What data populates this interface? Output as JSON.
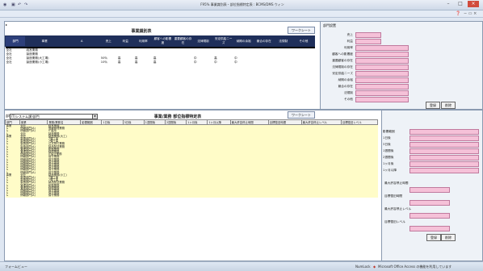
{
  "window": {
    "title": "F95% 事業識別表・部位指標特定表 : BCMS/DMS ウィン",
    "minimize": "–",
    "maximize": "□",
    "close": "×"
  },
  "ribbon": {
    "help": "❓",
    "controls": "− ▭ ×"
  },
  "top_section": {
    "title": "事業識別表",
    "worksheet_btn": "ワークシート",
    "columns": [
      "部門",
      "事業",
      "A",
      "売上",
      "利益",
      "利用率",
      "顧客への影響度",
      "重要顧客の存在",
      "法律規制",
      "安定供給ニーズ",
      "納期の余裕",
      "競合の存在",
      "法規制",
      "その他"
    ],
    "rows": [
      {
        "dept": "全社",
        "biz": "経営業務",
        "c1": "",
        "c2": "",
        "c3": "",
        "c4": "",
        "c5": "",
        "c6": "",
        "c7": ""
      },
      {
        "dept": "全社",
        "biz": "製造業務",
        "c1": "",
        "c2": "",
        "c3": "",
        "c4": "",
        "c5": "",
        "c6": "",
        "c7": ""
      },
      {
        "dept": "全社",
        "biz": "製造業務(大工場)",
        "c1": "50％",
        "c2": "高",
        "c3": "高",
        "c4": "高",
        "c5": "中",
        "c6": "高",
        "c7": "中"
      },
      {
        "dept": "全社",
        "biz": "製造業務(小工場)",
        "c1": "10％",
        "c2": "高",
        "c3": "高",
        "c4": "高",
        "c5": "中",
        "c6": "中",
        "c7": "中"
      }
    ]
  },
  "right_form": {
    "title": "部門設置",
    "labels": [
      "売上",
      "利益",
      "利用率",
      "顧客への影響度",
      "重要顧客の存在",
      "法律規制の存在",
      "安定供給ニーズ",
      "納期の余裕",
      "競合の存在",
      "法規制",
      "その他"
    ],
    "register_btn": "登録",
    "delete_btn": "削除"
  },
  "bottom_section": {
    "combo_label": "部門",
    "combo_value": "IT(システム課)部門",
    "title": "事業/業務 部位指標特定表",
    "worksheet_btn": "ワークシート",
    "columns": [
      "部門",
      "事業",
      "業務/業務名",
      "影響範囲",
      "1日後",
      "3日後",
      "1週間後",
      "2週間後",
      "1ヶ月後",
      "1ヶ月以降",
      "最大許容停止時間",
      "目標復旧時間",
      "最大許容停止レベル",
      "目標復旧レベル"
    ],
    "rows": [
      {
        "dept": "事業",
        "biz": "全社",
        "task": "経営業務"
      },
      {
        "dept": "↳",
        "biz": "情報部門(A)",
        "task": "情報管理業務"
      },
      {
        "dept": "↳",
        "biz": "情報部門(A)",
        "task": "IT運用"
      },
      {
        "dept": "↳",
        "biz": "全社",
        "task": "製造業務"
      },
      {
        "dept": "事業",
        "biz": "全社",
        "task": "製造業務(大工)"
      },
      {
        "dept": "↳",
        "biz": "製造部門(A)",
        "task": "7課工事"
      },
      {
        "dept": "↳",
        "biz": "製造部門(A)",
        "task": "7課工事"
      },
      {
        "dept": "↳",
        "biz": "製造部門(A)",
        "task": "注文受付業務"
      },
      {
        "dept": "↳",
        "biz": "製造部門(A)",
        "task": "製品配送業務"
      },
      {
        "dept": "↳",
        "biz": "管理部門(A)",
        "task": "総務業務"
      },
      {
        "dept": "↳",
        "biz": "管理部門(A)",
        "task": "経理業務"
      },
      {
        "dept": "↳",
        "biz": "情報部門(A)",
        "task": "IT保守業務"
      },
      {
        "dept": "↳",
        "biz": "情報部門(A)",
        "task": "保守業務"
      },
      {
        "dept": "↳",
        "biz": "情報部門(A)",
        "task": "保守業務"
      },
      {
        "dept": "↳",
        "biz": "情報部門(A)",
        "task": "保守業務"
      },
      {
        "dept": "↳",
        "biz": "情報部門(A)",
        "task": "保守業務"
      },
      {
        "dept": "↳",
        "biz": "情報部門(A)",
        "task": "保守業務"
      },
      {
        "dept": "↳",
        "biz": "情報部門(A)",
        "task": "保守業務"
      },
      {
        "dept": "↳",
        "biz": "情報部門(A)",
        "task": "保守業務"
      },
      {
        "dept": "事業",
        "biz": "全社",
        "task": "製造業務(小工)"
      },
      {
        "dept": "↳",
        "biz": "製造部門(A)",
        "task": "7課工事"
      },
      {
        "dept": "↳",
        "biz": "製造部門(A)",
        "task": "7課工事"
      },
      {
        "dept": "↳",
        "biz": "製造部門(A)",
        "task": "製品配送業務"
      },
      {
        "dept": "↳",
        "biz": "管理部門(A)",
        "task": "総務業務"
      },
      {
        "dept": "↳",
        "biz": "管理部門(A)",
        "task": "経理業務"
      },
      {
        "dept": "↳",
        "biz": "情報部門(A)",
        "task": "保守業務"
      },
      {
        "dept": "↳",
        "biz": "情報部門(A)",
        "task": "保守業務"
      },
      {
        "dept": "↳",
        "biz": "情報部門(A)",
        "task": "保守業務"
      }
    ]
  },
  "bottom_form": {
    "labels": [
      "影響範囲",
      "1日後",
      "3日後",
      "1週間後",
      "2週間後",
      "1ヶ月後",
      "1ヶ月以降"
    ],
    "max_time": "最大許容停止時間",
    "target_time": "目標復旧時間",
    "max_level": "最大許容停止レベル",
    "target_level": "目標復旧レベル",
    "register_btn": "登録",
    "delete_btn": "削除"
  },
  "status": {
    "left": "フォームビュー",
    "numlock": "NumLock",
    "product": "Microsoft Office Access の機能を利用しています"
  }
}
